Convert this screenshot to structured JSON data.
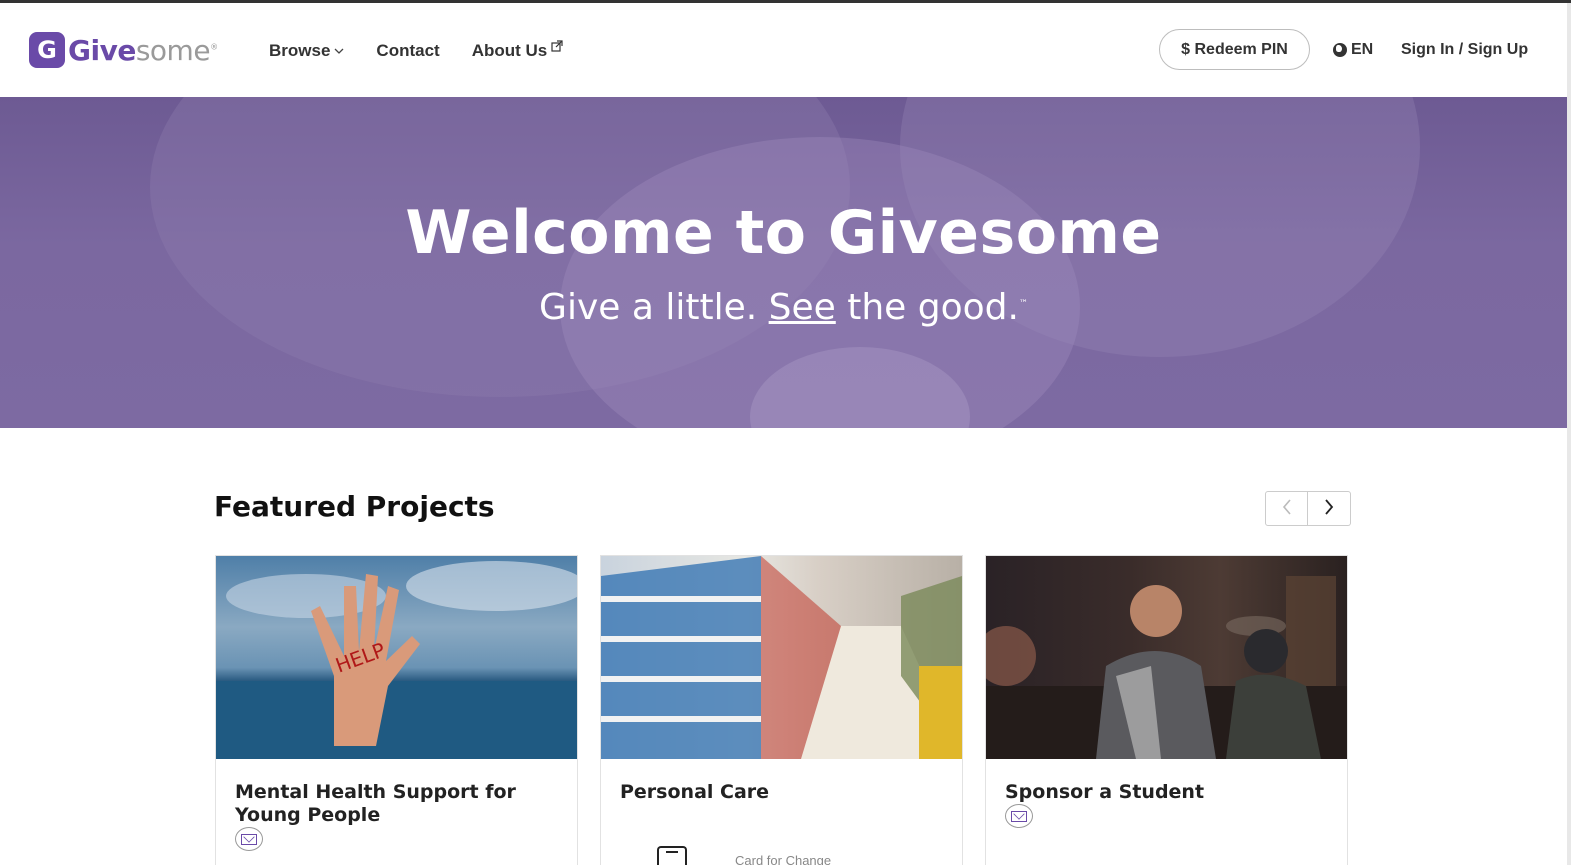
{
  "header": {
    "logo": {
      "mark": "G",
      "brand_part1": "Give",
      "brand_part2": "some",
      "reg": "®"
    },
    "nav": {
      "browse": "Browse",
      "contact": "Contact",
      "about": "About Us"
    },
    "redeem_label": "$ Redeem PIN",
    "language": "EN",
    "signin_label": "Sign In / Sign Up"
  },
  "hero": {
    "title": "Welcome to Givesome",
    "subtitle_pre": "Give a little. ",
    "subtitle_emph": "See",
    "subtitle_post": " the good.",
    "subtitle_tm": "™"
  },
  "featured": {
    "title": "Featured Projects",
    "prev_icon": "chevron-left-icon",
    "next_icon": "chevron-right-icon",
    "cards": [
      {
        "title": "Mental Health Support for Young People",
        "badge_icon": "envelope-icon",
        "image_icon": "help-hand-in-water-photo"
      },
      {
        "title": "Personal Care",
        "footer_text": "Card for Change",
        "footer_icon": "phone-icon",
        "image_icon": "pharmacy-aisle-photo"
      },
      {
        "title": "Sponsor a Student",
        "badge_icon": "envelope-icon",
        "image_icon": "mentor-and-student-photo"
      }
    ]
  },
  "colors": {
    "brand_purple": "#6a4aa8",
    "hero_overlay": "#7b68a0",
    "text_dark": "#222222"
  }
}
